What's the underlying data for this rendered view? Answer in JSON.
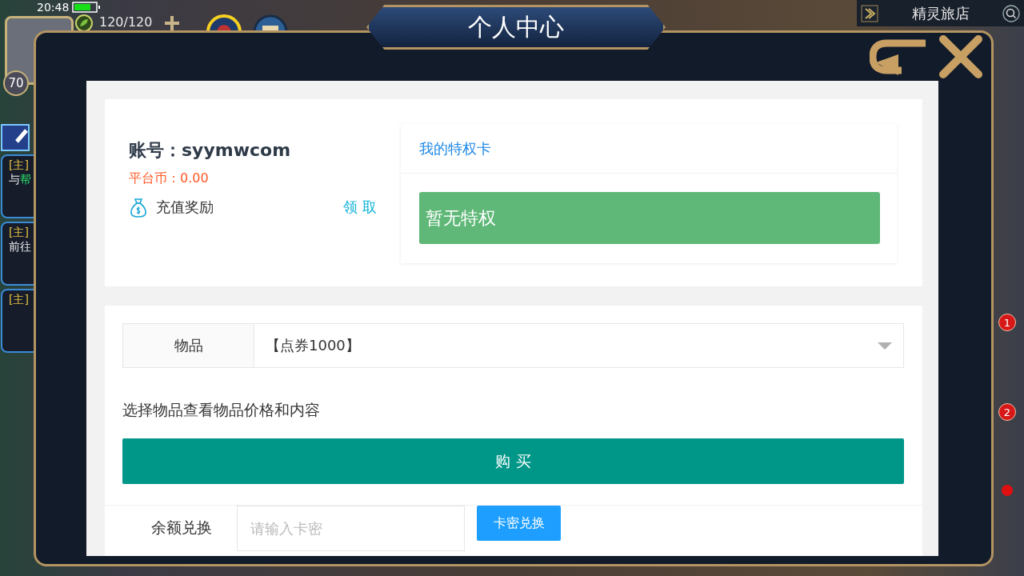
{
  "hud": {
    "time": "20:48",
    "level": "70",
    "energy": "120/120"
  },
  "location": {
    "title": "精灵旅店"
  },
  "quests": [
    {
      "tag": "[主]",
      "text": "与",
      "highlight": "帮"
    },
    {
      "tag": "[主]",
      "text": "前往"
    },
    {
      "tag": "[主]"
    }
  ],
  "side_badges": [
    "1",
    "2"
  ],
  "dialog": {
    "title": "个人中心",
    "account": {
      "label": "账号：syymwcom",
      "coins": "平台币：0.00",
      "reward_label": "充值奖励",
      "reward_action": "领 取"
    },
    "privilege": {
      "header": "我的特权卡",
      "empty": "暂无特权"
    },
    "shop": {
      "item_label": "物品",
      "item_value": "【点券1000】",
      "hint": "选择物品查看物品价格和内容",
      "buy": "购 买"
    },
    "exchange": {
      "label": "余额兑换",
      "placeholder": "请输入卡密",
      "button": "卡密兑换"
    }
  }
}
